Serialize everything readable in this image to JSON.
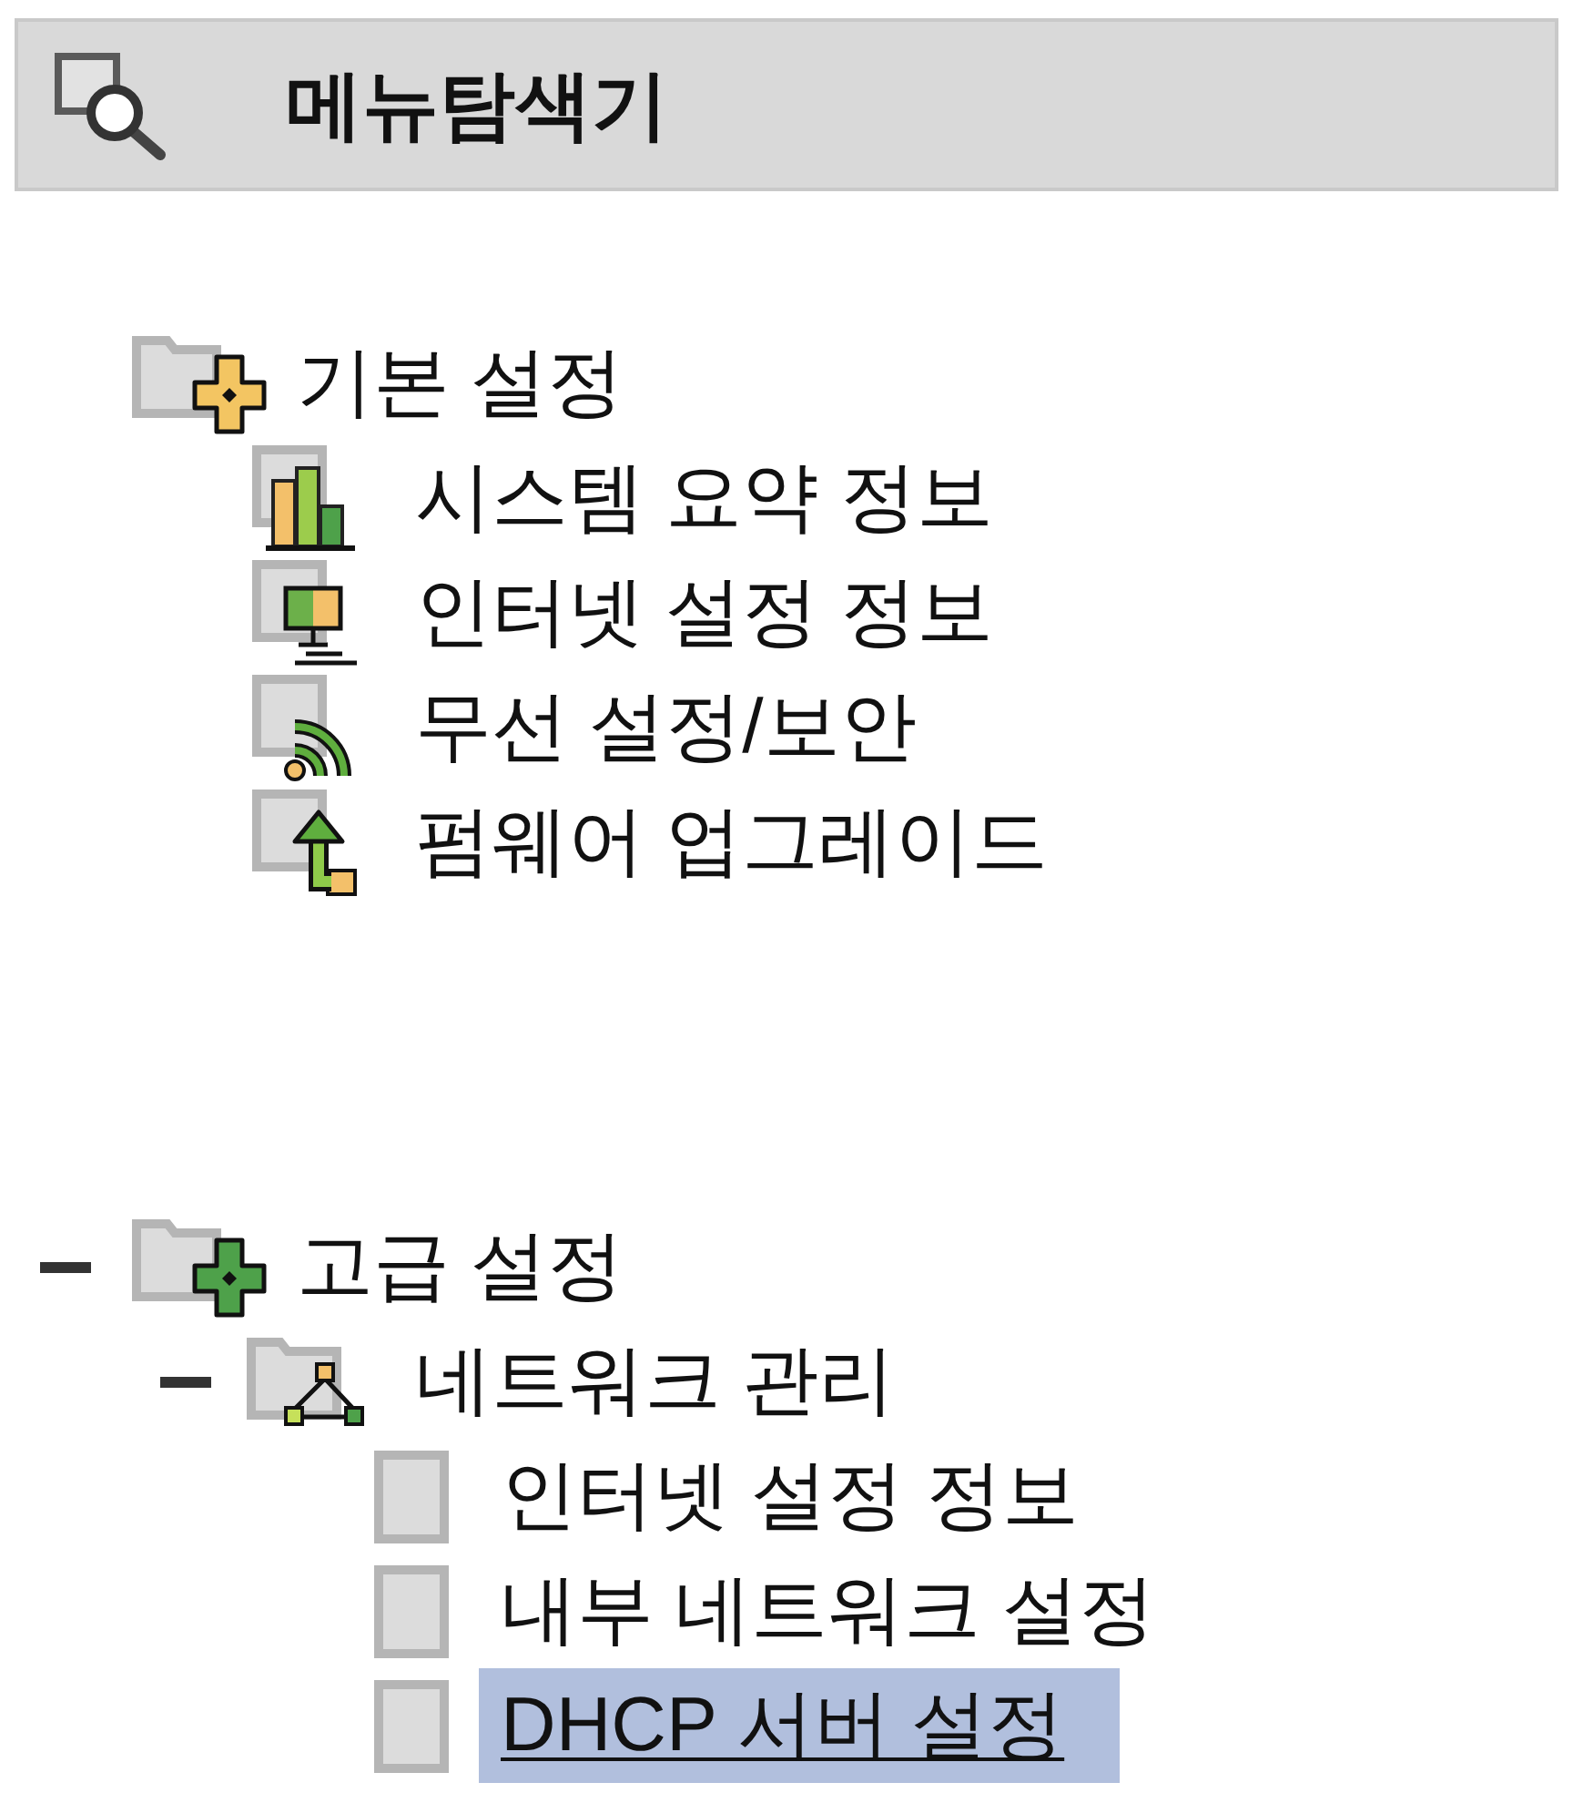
{
  "header": {
    "title": "메뉴탐색기"
  },
  "tree": [
    {
      "label": "기본 설정",
      "kind": "folder",
      "selected": false,
      "children": [
        {
          "label": "시스템 요약 정보",
          "kind": "page",
          "selected": false
        },
        {
          "label": "인터넷 설정 정보",
          "kind": "page",
          "selected": false
        },
        {
          "label": "무선 설정/보안",
          "kind": "page",
          "selected": false
        },
        {
          "label": "펌웨어 업그레이드",
          "kind": "page",
          "selected": false
        }
      ]
    },
    {
      "label": "고급 설정",
      "kind": "folder",
      "selected": false,
      "expanded": true,
      "children": [
        {
          "label": "네트워크 관리",
          "kind": "folder",
          "selected": false,
          "expanded": true,
          "children": [
            {
              "label": "인터넷 설정 정보",
              "kind": "page",
              "selected": false
            },
            {
              "label": "내부 네트워크 설정",
              "kind": "page",
              "selected": false
            },
            {
              "label": "DHCP 서버 설정",
              "kind": "page",
              "selected": true
            }
          ]
        }
      ]
    }
  ]
}
